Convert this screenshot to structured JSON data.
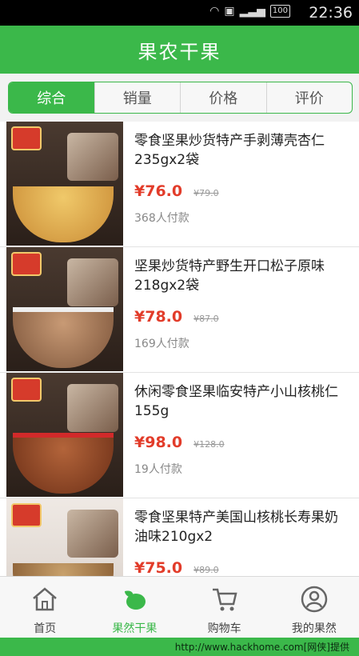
{
  "status_bar": {
    "time": "22:36",
    "battery": "100"
  },
  "header": {
    "title": "果农干果"
  },
  "tabs": [
    {
      "label": "综合",
      "active": true
    },
    {
      "label": "销量",
      "active": false
    },
    {
      "label": "价格",
      "active": false
    },
    {
      "label": "评价",
      "active": false
    }
  ],
  "products": [
    {
      "name": "零食坚果炒货特产手剥薄壳杏仁235gx2袋",
      "price": "¥76.0",
      "original_price": "¥79.0",
      "paid": "368人付款"
    },
    {
      "name": "坚果炒货特产野生开口松子原味218gx2袋",
      "price": "¥78.0",
      "original_price": "¥87.0",
      "paid": "169人付款"
    },
    {
      "name": "休闲零食坚果临安特产小山核桃仁155g",
      "price": "¥98.0",
      "original_price": "¥128.0",
      "paid": "19人付款"
    },
    {
      "name": "零食坚果特产美国山核桃长寿果奶油味210gx2",
      "price": "¥75.0",
      "original_price": "¥89.0",
      "paid": ""
    }
  ],
  "bottom_nav": [
    {
      "label": "首页",
      "icon": "home-icon",
      "active": false
    },
    {
      "label": "果然干果",
      "icon": "nut-leaf-icon",
      "active": true
    },
    {
      "label": "购物车",
      "icon": "cart-icon",
      "active": false
    },
    {
      "label": "我的果然",
      "icon": "profile-icon",
      "active": false
    }
  ],
  "watermark": "http://www.hackhome.com[网侠]提供",
  "colors": {
    "brand_green": "#3bb84a",
    "price_red": "#e23c2a"
  }
}
